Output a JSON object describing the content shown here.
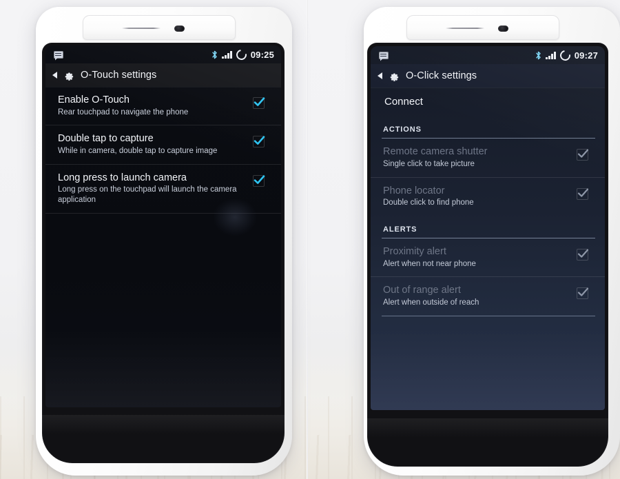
{
  "scene": {
    "description": "Two white OPPO smartphones side by side on a light surface",
    "accent_check": "#2ec3f0",
    "disabled_check": "#7d8595",
    "screen_bg_left": "#0a0c12",
    "screen_bg_right": "#1b2232"
  },
  "left_phone": {
    "status_bar": {
      "notification_icon": "message-icon",
      "bluetooth_icon": "bluetooth-icon",
      "signal_icon": "signal-bars-icon",
      "alarm_icon": "alarm-icon",
      "time": "09:25"
    },
    "action_bar": {
      "back_icon": "chevron-left-icon",
      "app_icon": "gear-icon",
      "title": "O-Touch settings"
    },
    "settings": [
      {
        "title": "Enable O-Touch",
        "subtitle": "Rear touchpad to navigate the phone",
        "checked": true,
        "enabled": true
      },
      {
        "title": "Double tap to capture",
        "subtitle": "While in camera, double tap to capture image",
        "checked": true,
        "enabled": true
      },
      {
        "title": "Long press to launch camera",
        "subtitle": "Long press on the touchpad will launch the camera application",
        "checked": true,
        "enabled": true
      }
    ]
  },
  "right_phone": {
    "status_bar": {
      "notification_icon": "message-icon",
      "bluetooth_icon": "bluetooth-icon",
      "signal_icon": "signal-bars-icon",
      "alarm_icon": "alarm-icon",
      "time": "09:27"
    },
    "action_bar": {
      "back_icon": "chevron-left-icon",
      "app_icon": "gear-icon",
      "title": "O-Click settings"
    },
    "connect": {
      "label": "Connect"
    },
    "sections": [
      {
        "header": "ACTIONS",
        "items": [
          {
            "title": "Remote camera shutter",
            "subtitle": "Single click to take picture",
            "checked": true,
            "enabled": false
          },
          {
            "title": "Phone locator",
            "subtitle": "Double click to find phone",
            "checked": true,
            "enabled": false
          }
        ]
      },
      {
        "header": "ALERTS",
        "items": [
          {
            "title": "Proximity alert",
            "subtitle": "Alert when not near phone",
            "checked": true,
            "enabled": false
          },
          {
            "title": "Out of range alert",
            "subtitle": "Alert when outside of reach",
            "checked": true,
            "enabled": false
          }
        ]
      }
    ]
  }
}
